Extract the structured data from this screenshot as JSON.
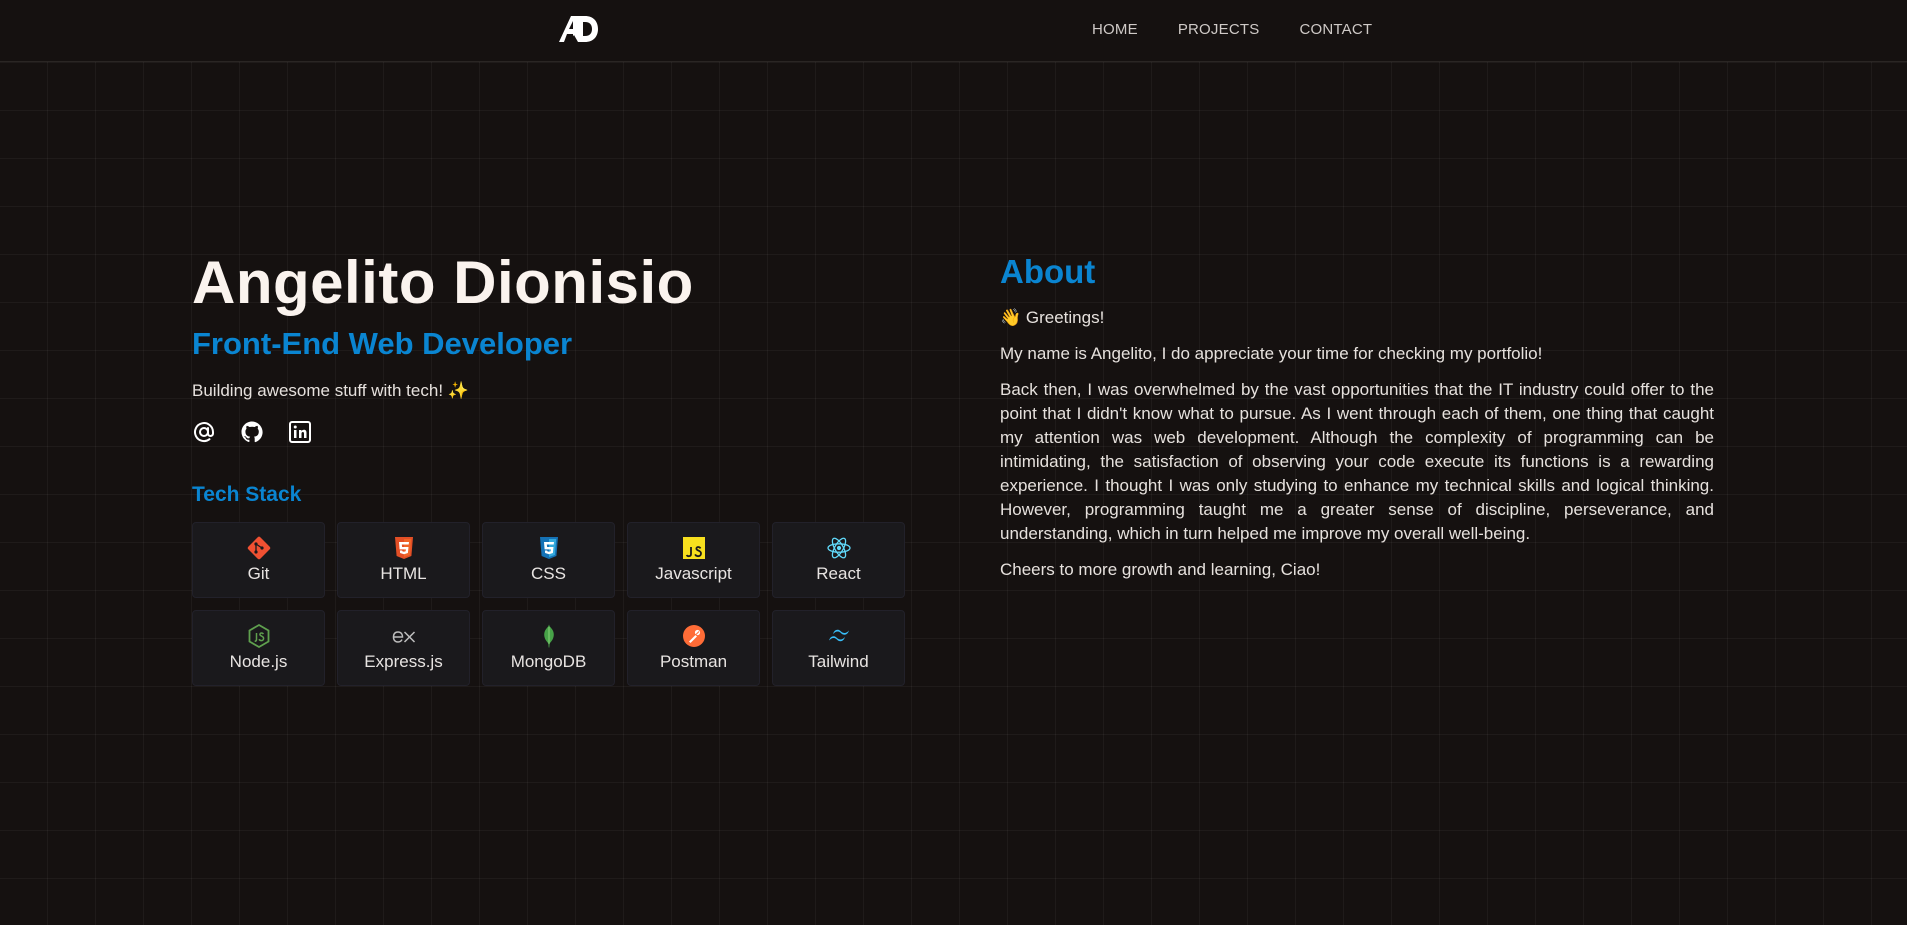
{
  "nav": {
    "logo_text": "AD",
    "links": [
      "HOME",
      "PROJECTS",
      "CONTACT"
    ]
  },
  "hero": {
    "name": "Angelito Dionisio",
    "role": "Front-End Web Developer",
    "tagline": "Building awesome stuff with tech! ✨",
    "socials": [
      "at-sign-icon",
      "github-icon",
      "linkedin-icon"
    ]
  },
  "tech_stack": {
    "title": "Tech Stack",
    "items": [
      {
        "label": "Git",
        "icon": "git-icon",
        "color": "#f05032"
      },
      {
        "label": "HTML",
        "icon": "html5-icon",
        "color": "#e34f26"
      },
      {
        "label": "CSS",
        "icon": "css3-icon",
        "color": "#1572b6"
      },
      {
        "label": "Javascript",
        "icon": "javascript-icon",
        "color": "#f7df1e"
      },
      {
        "label": "React",
        "icon": "react-icon",
        "color": "#61dafb"
      },
      {
        "label": "Node.js",
        "icon": "nodejs-icon",
        "color": "#5fa04e"
      },
      {
        "label": "Express.js",
        "icon": "express-icon",
        "color": "#bdbdbd"
      },
      {
        "label": "MongoDB",
        "icon": "mongodb-icon",
        "color": "#47a248"
      },
      {
        "label": "Postman",
        "icon": "postman-icon",
        "color": "#ff6c37"
      },
      {
        "label": "Tailwind",
        "icon": "tailwind-icon",
        "color": "#38bdf8"
      }
    ]
  },
  "about": {
    "title": "About",
    "paragraphs": [
      "👋 Greetings!",
      "My name is Angelito, I do appreciate your time for checking my portfolio!",
      "Back then, I was overwhelmed by the vast opportunities that the IT industry could offer to the point that I didn't know what to pursue. As I went through each of them, one thing that caught my attention was web development. Although the complexity of programming can be intimidating, the satisfaction of observing your code execute its functions is a rewarding experience. I thought I was only studying to enhance my technical skills and logical thinking. However, programming taught me a greater sense of discipline, perseverance, and understanding, which in turn helped me improve my overall well-being.",
      "Cheers to more growth and learning, Ciao!"
    ]
  },
  "colors": {
    "background": "#151110",
    "accent": "#0a85d1",
    "heading": "#faf3ee",
    "card": "#1a191c"
  }
}
